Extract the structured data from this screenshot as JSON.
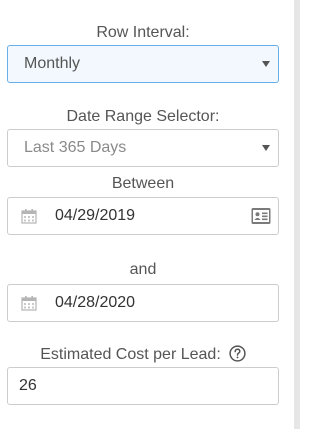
{
  "row_interval": {
    "label": "Row Interval:",
    "selected": "Monthly"
  },
  "date_range": {
    "label": "Date Range Selector:",
    "selected": "Last 365 Days"
  },
  "between_label": "Between",
  "start_date": {
    "value": "04/29/2019",
    "icon": "calendar-icon",
    "side_icon": "contact-card-icon"
  },
  "and_label": "and",
  "end_date": {
    "value": "04/28/2020",
    "icon": "calendar-icon"
  },
  "cost_per_lead": {
    "label": "Estimated Cost per Lead:",
    "help_icon": "question-circle-icon",
    "value": "26"
  },
  "colors": {
    "focus_border": "#66afe9",
    "focus_background": "#f2f8fd",
    "border": "#cccccc",
    "text": "#555555"
  }
}
